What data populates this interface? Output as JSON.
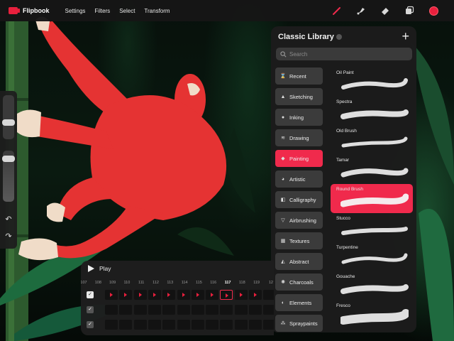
{
  "app": {
    "title": "Flipbook"
  },
  "menu": [
    "Settings",
    "Filters",
    "Select",
    "Transform"
  ],
  "tools": [
    {
      "name": "brush-tool",
      "icon": "brush-icon",
      "active": true,
      "color": "#f02a4c"
    },
    {
      "name": "smudge-tool",
      "icon": "smudge-icon",
      "active": false,
      "color": "#d8d8d8"
    },
    {
      "name": "eraser-tool",
      "icon": "eraser-icon",
      "active": false,
      "color": "#d8d8d8"
    },
    {
      "name": "layers-tool",
      "icon": "layers-icon",
      "active": false,
      "color": "#d8d8d8"
    },
    {
      "name": "color-picker",
      "icon": "color-swatch",
      "active": false,
      "color": "#e8203d"
    }
  ],
  "library": {
    "title": "Classic Library",
    "add_icon": "plus-icon",
    "search_placeholder": "Search",
    "sets": [
      {
        "label": "Recent",
        "icon": "hourglass-icon",
        "glyph": "⌛",
        "active": false
      },
      {
        "label": "Sketching",
        "icon": "pencil-icon",
        "glyph": "▲",
        "active": false
      },
      {
        "label": "Inking",
        "icon": "ink-drop-icon",
        "glyph": "●",
        "active": false
      },
      {
        "label": "Drawing",
        "icon": "drawing-icon",
        "glyph": "≋",
        "active": false
      },
      {
        "label": "Painting",
        "icon": "paint-icon",
        "glyph": "◆",
        "active": true
      },
      {
        "label": "Artistic",
        "icon": "palette-icon",
        "glyph": "◕",
        "active": false
      },
      {
        "label": "Calligraphy",
        "icon": "calligraphy-icon",
        "glyph": "◧",
        "active": false
      },
      {
        "label": "Airbrushing",
        "icon": "airbrush-icon",
        "glyph": "▽",
        "active": false
      },
      {
        "label": "Textures",
        "icon": "texture-icon",
        "glyph": "▦",
        "active": false
      },
      {
        "label": "Abstract",
        "icon": "abstract-icon",
        "glyph": "◭",
        "active": false
      },
      {
        "label": "Charcoals",
        "icon": "charcoal-icon",
        "glyph": "✺",
        "active": false
      },
      {
        "label": "Elements",
        "icon": "elements-icon",
        "glyph": "◐",
        "active": false
      },
      {
        "label": "Spraypaints",
        "icon": "spray-icon",
        "glyph": "⁂",
        "active": false
      }
    ],
    "brushes": [
      {
        "label": "Oil Paint",
        "active": false
      },
      {
        "label": "Spectra",
        "active": false
      },
      {
        "label": "Old Brush",
        "active": false
      },
      {
        "label": "Tamar",
        "active": false
      },
      {
        "label": "Round Brush",
        "active": true
      },
      {
        "label": "Stucco",
        "active": false
      },
      {
        "label": "Turpentine",
        "active": false
      },
      {
        "label": "Gouache",
        "active": false
      },
      {
        "label": "Fresco",
        "active": false
      }
    ]
  },
  "timeline": {
    "play_label": "Play",
    "frame_numbers": [
      "107",
      "108",
      "109",
      "110",
      "111",
      "112",
      "113",
      "114",
      "115",
      "116",
      "117",
      "118",
      "119",
      "12"
    ],
    "current_frame": "117",
    "rows": 3,
    "active_row": 0,
    "keyframe_row_cells": 11
  },
  "colors": {
    "accent": "#f02a4c",
    "figure": "#e53333",
    "panel": "#1c1c1c"
  }
}
